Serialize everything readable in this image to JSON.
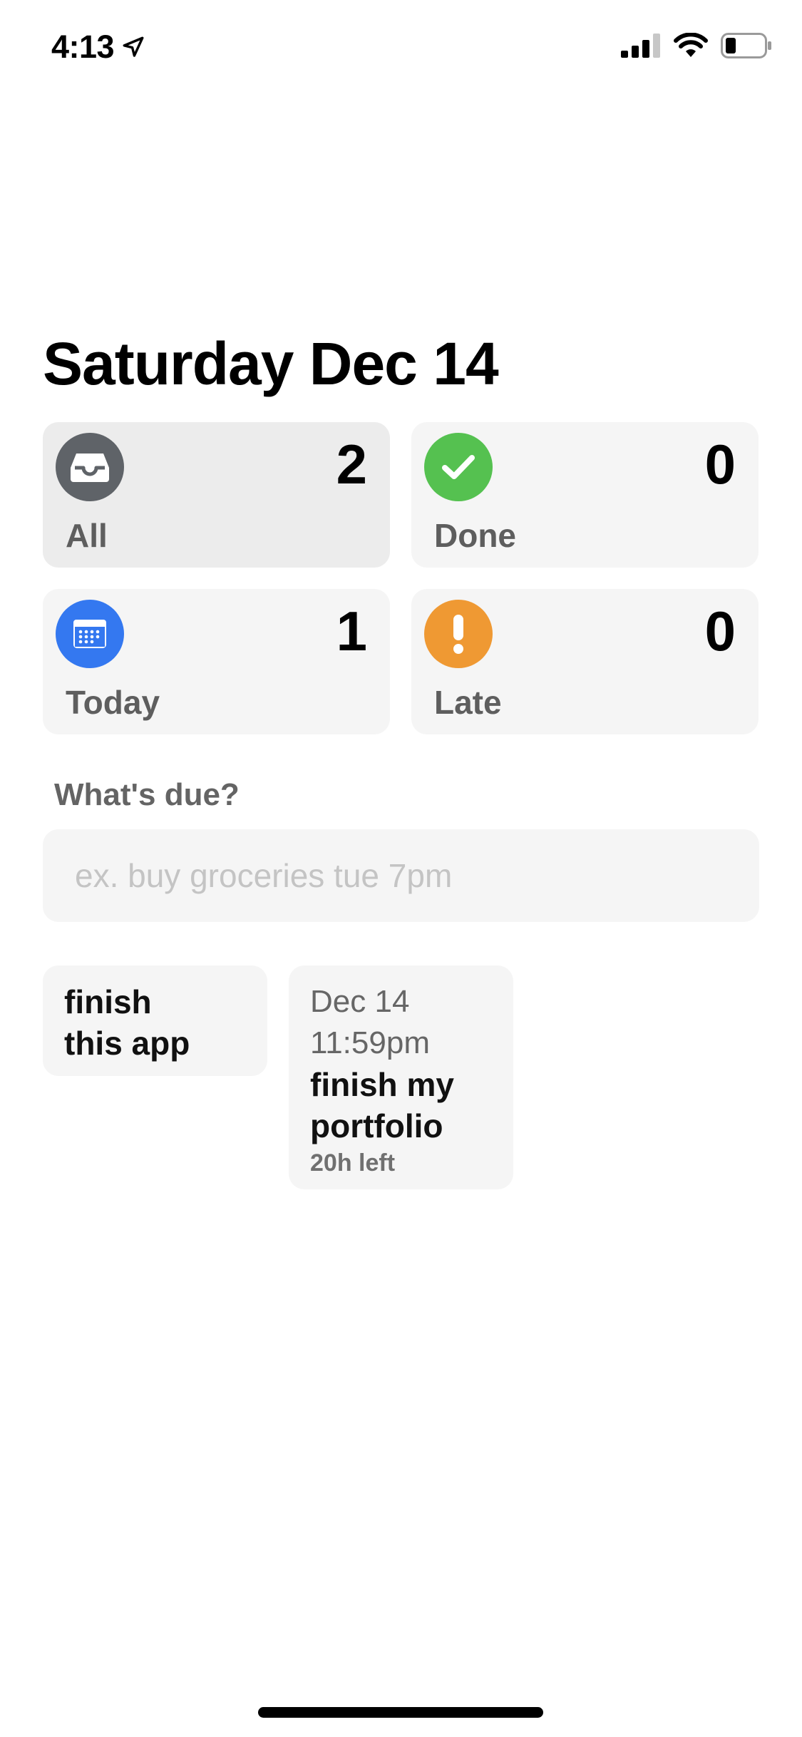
{
  "status_bar": {
    "time": "4:13"
  },
  "header": {
    "title": "Saturday Dec 14"
  },
  "summary": [
    {
      "label": "All",
      "count": "2",
      "icon": "tray-icon",
      "color": "#5f6368"
    },
    {
      "label": "Done",
      "count": "0",
      "icon": "checkmark-icon",
      "color": "#55c150"
    },
    {
      "label": "Today",
      "count": "1",
      "icon": "calendar-icon",
      "color": "#3478f0"
    },
    {
      "label": "Late",
      "count": "0",
      "icon": "exclamation-icon",
      "color": "#ef9933"
    }
  ],
  "input": {
    "label": "What's due?",
    "placeholder": "ex. buy groceries tue 7pm",
    "value": ""
  },
  "tasks": [
    {
      "title_line1": "finish",
      "title_line2": "this app"
    },
    {
      "due_date": "Dec 14",
      "due_time": "11:59pm",
      "title_line1": "finish my",
      "title_line2": "portfolio",
      "time_left": "20h left"
    }
  ]
}
